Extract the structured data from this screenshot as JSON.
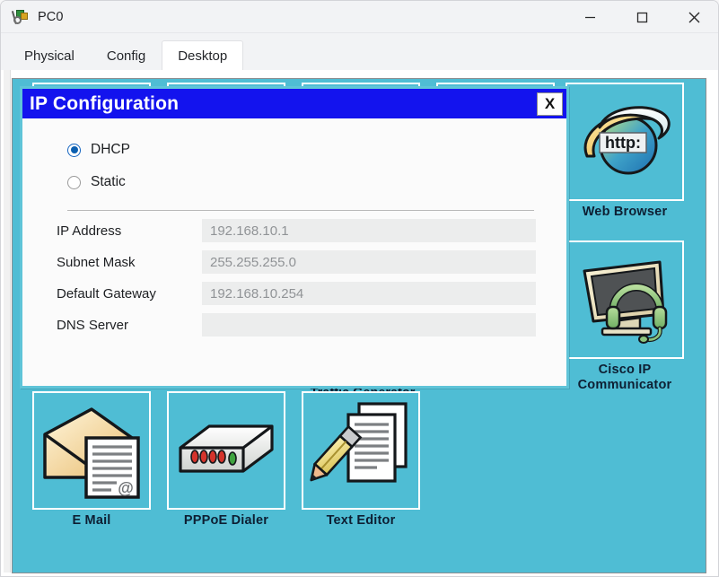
{
  "window": {
    "title": "PC0",
    "icon": "packet-tracer-icon",
    "controls": {
      "minimize": "minimize-icon",
      "maximize": "maximize-icon",
      "close": "close-icon"
    }
  },
  "tabs": [
    {
      "label": "Physical",
      "active": false
    },
    {
      "label": "Config",
      "active": false
    },
    {
      "label": "Desktop",
      "active": true
    }
  ],
  "desktop": {
    "background_color": "#4fbdd4",
    "icons_row_top": [
      {
        "label": "",
        "icon": "hidden-app-icon-1"
      },
      {
        "label": "",
        "icon": "hidden-app-icon-2"
      },
      {
        "label": "",
        "icon": "hidden-app-icon-3"
      },
      {
        "label": "",
        "icon": "hidden-app-icon-4"
      }
    ],
    "icons_right": [
      {
        "label": "Web Browser",
        "icon": "globe-http-icon"
      },
      {
        "label": "Cisco IP\nCommunicator",
        "label_line1": "Cisco IP",
        "label_line2": "Communicator",
        "icon": "monitor-headset-icon"
      }
    ],
    "icons_bottom": [
      {
        "label": "E Mail",
        "icon": "envelope-document-icon"
      },
      {
        "label": "PPPoE Dialer",
        "icon": "modem-device-icon"
      },
      {
        "label": "Text Editor",
        "icon": "pencil-pages-icon"
      }
    ],
    "clipped_label": "Traffic Generator"
  },
  "ipconfig": {
    "title": "IP Configuration",
    "close_label": "X",
    "title_bar_color": "#1313ee",
    "mode_options": [
      {
        "label": "DHCP",
        "selected": true
      },
      {
        "label": "Static",
        "selected": false
      }
    ],
    "fields": [
      {
        "label": "IP Address",
        "value": "192.168.10.1"
      },
      {
        "label": "Subnet Mask",
        "value": "255.255.255.0"
      },
      {
        "label": "Default Gateway",
        "value": "192.168.10.254"
      },
      {
        "label": "DNS Server",
        "value": ""
      }
    ]
  }
}
